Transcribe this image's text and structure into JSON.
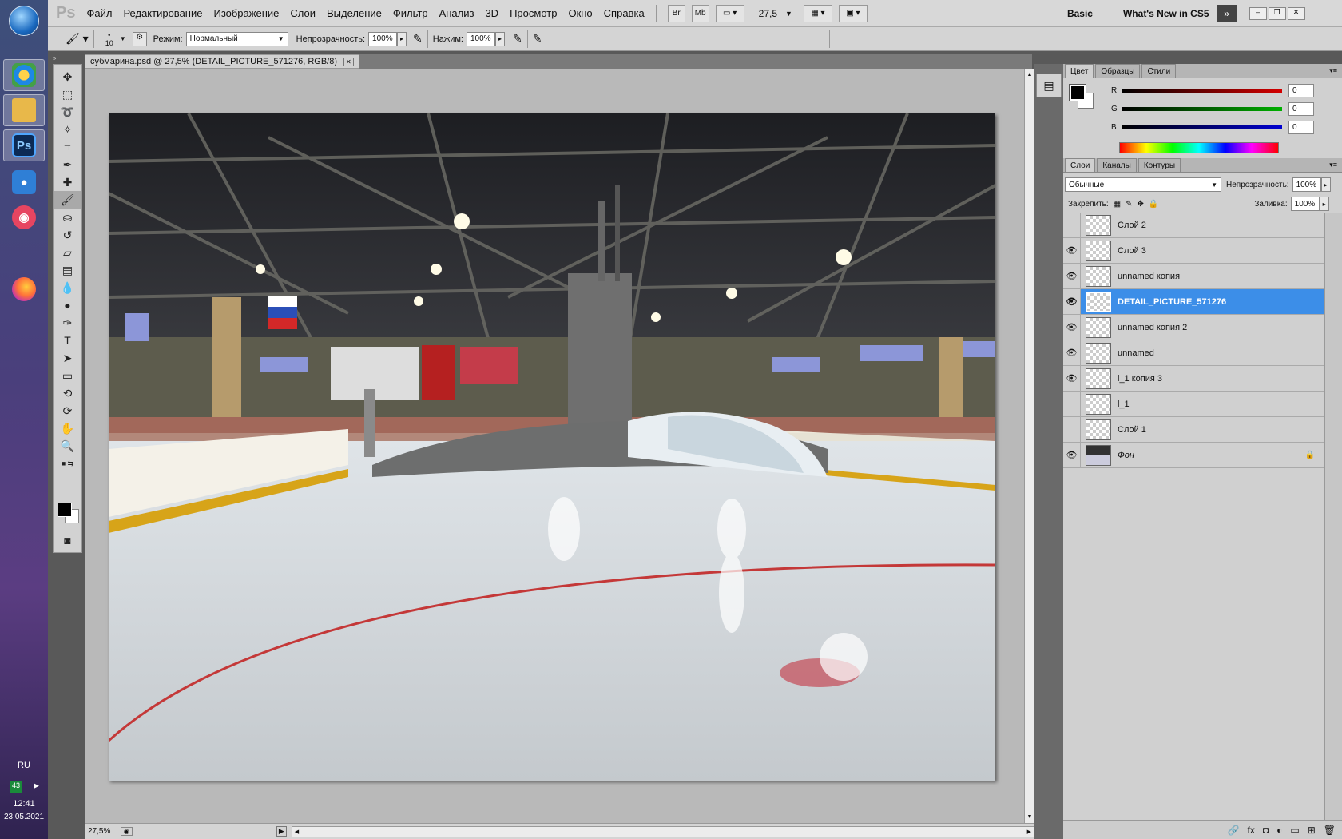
{
  "taskbar": {
    "apps": [
      {
        "icon": "windows-orb-icon"
      },
      {
        "icon": "browser-icon"
      },
      {
        "icon": "file-explorer-icon"
      },
      {
        "icon": "photoshop-icon",
        "label": "Ps"
      },
      {
        "icon": "camera-icon"
      },
      {
        "icon": "screen-recorder-icon"
      },
      {
        "icon": "firefox-icon"
      }
    ],
    "language": "RU",
    "badge": "43",
    "time": "12:41",
    "date": "23.05.2021"
  },
  "menubar": {
    "logo": "Ps",
    "items": [
      "Файл",
      "Редактирование",
      "Изображение",
      "Слои",
      "Выделение",
      "Фильтр",
      "Анализ",
      "3D",
      "Просмотр",
      "Окно",
      "Справка"
    ],
    "br": "Br",
    "mb": "Mb",
    "zoom": "27,5",
    "workspace": "Basic",
    "whats_new": "What's New in CS5"
  },
  "options": {
    "brush_size": "10",
    "mode_label": "Режим:",
    "mode_value": "Нормальный",
    "opacity_label": "Непрозрачность:",
    "opacity_value": "100%",
    "flow_label": "Нажим:",
    "flow_value": "100%"
  },
  "document": {
    "tab_title": "субмарина.psd @ 27,5% (DETAIL_PICTURE_571276, RGB/8)",
    "status_zoom": "27,5%"
  },
  "color_panel": {
    "tabs": [
      "Цвет",
      "Образцы",
      "Стили"
    ],
    "channels": [
      {
        "label": "R",
        "value": "0",
        "color": "#d40000"
      },
      {
        "label": "G",
        "value": "0",
        "color": "#00b000"
      },
      {
        "label": "B",
        "value": "0",
        "color": "#0000d0"
      }
    ]
  },
  "layers_panel": {
    "tabs": [
      "Слои",
      "Каналы",
      "Контуры"
    ],
    "blend_mode": "Обычные",
    "opacity_label": "Непрозрачность:",
    "opacity_value": "100%",
    "lock_label": "Закрепить:",
    "fill_label": "Заливка:",
    "fill_value": "100%",
    "layers": [
      {
        "name": "Слой 2",
        "visible": false,
        "selected": false
      },
      {
        "name": "Слой 3",
        "visible": true,
        "selected": false
      },
      {
        "name": "unnamed копия",
        "visible": true,
        "selected": false
      },
      {
        "name": "DETAIL_PICTURE_571276",
        "visible": true,
        "selected": true
      },
      {
        "name": "unnamed копия 2",
        "visible": true,
        "selected": false
      },
      {
        "name": "unnamed",
        "visible": true,
        "selected": false
      },
      {
        "name": "l_1 копия 3",
        "visible": true,
        "selected": false
      },
      {
        "name": "l_1",
        "visible": false,
        "selected": false
      },
      {
        "name": "Слой 1",
        "visible": false,
        "selected": false
      },
      {
        "name": "Фон",
        "visible": true,
        "selected": false,
        "locked": true
      }
    ]
  }
}
